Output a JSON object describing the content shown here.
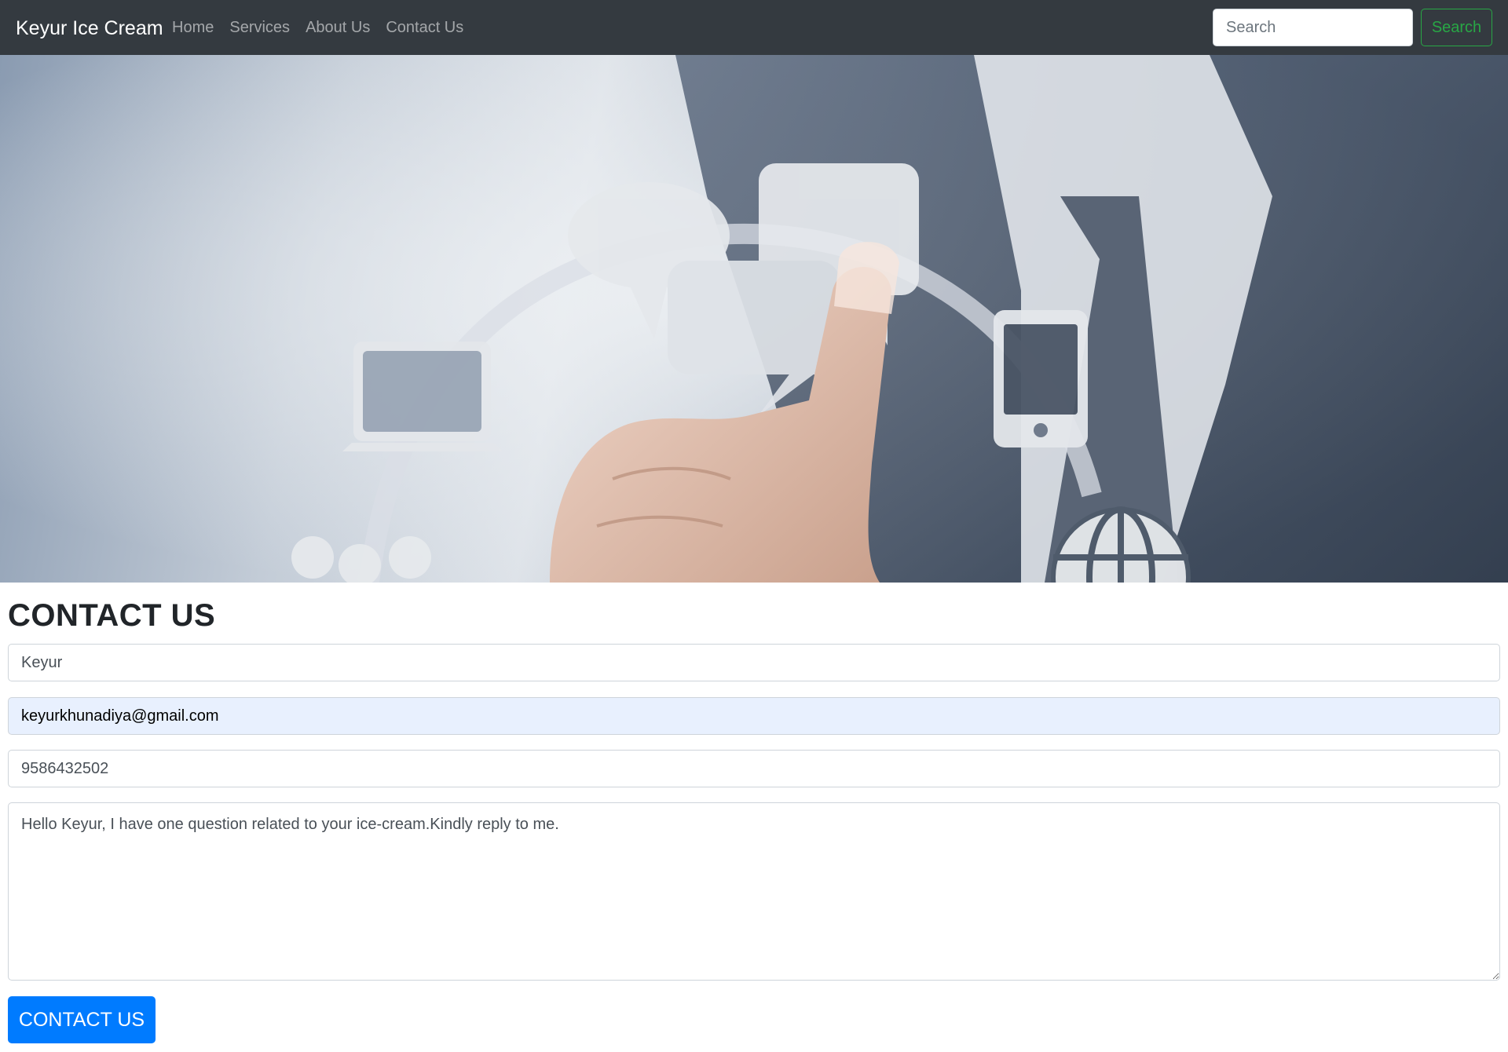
{
  "navbar": {
    "brand": "Keyur Ice Cream",
    "links": [
      {
        "label": "Home"
      },
      {
        "label": "Services"
      },
      {
        "label": "About Us"
      },
      {
        "label": "Contact Us"
      }
    ],
    "search": {
      "placeholder": "Search",
      "value": "",
      "button_label": "Search"
    }
  },
  "hero": {
    "image": "businessman pointing at communication icons (speech bubbles, laptop, phone, people, globe)",
    "icons": [
      "speech-bubble-icon",
      "laptop-icon",
      "phone-icon",
      "people-icon",
      "globe-icon"
    ]
  },
  "contact": {
    "title": "CONTACT US",
    "name_value": "Keyur",
    "email_value": "keyurkhunadiya@gmail.com",
    "phone_value": "9586432502",
    "message_value": "Hello Keyur, I have one question related to your ice-cream.Kindly reply to me.",
    "submit_label": "CONTACT US"
  },
  "colors": {
    "navbar_bg": "#343a40",
    "search_button": "#28a745",
    "primary_button": "#007bff",
    "autofill_bg": "#e8f0fe"
  }
}
